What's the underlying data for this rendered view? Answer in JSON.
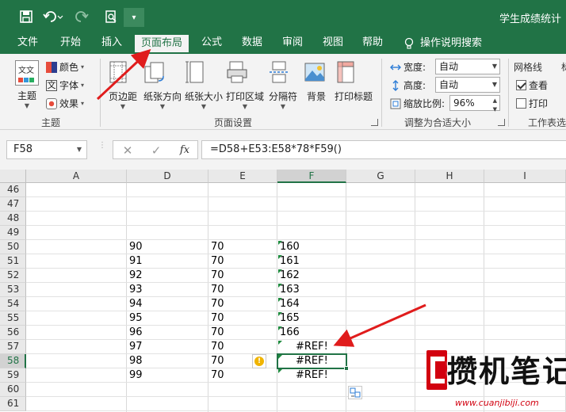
{
  "titlebar": {
    "doc_title": "学生成绩统计",
    "qat_more": "▾"
  },
  "tabs": [
    {
      "label": "文件"
    },
    {
      "label": "开始"
    },
    {
      "label": "插入"
    },
    {
      "label": "页面布局",
      "active": true
    },
    {
      "label": "公式"
    },
    {
      "label": "数据"
    },
    {
      "label": "审阅"
    },
    {
      "label": "视图"
    },
    {
      "label": "帮助"
    },
    {
      "label": "操作说明搜索"
    }
  ],
  "ribbon": {
    "theme_group": {
      "theme_label": "主题",
      "colors_label": "颜色",
      "fonts_label": "字体",
      "effects_label": "效果",
      "group_label": "主题"
    },
    "page_setup": {
      "margins": "页边距",
      "orientation": "纸张方向",
      "size": "纸张大小",
      "print_area": "打印区域",
      "breaks": "分隔符",
      "background": "背景",
      "print_titles": "打印标题",
      "group_label": "页面设置"
    },
    "scale": {
      "width_label": "宽度:",
      "width_value": "自动",
      "height_label": "高度:",
      "height_value": "自动",
      "scale_label": "缩放比例:",
      "scale_value": "96%",
      "group_label": "调整为合适大小"
    },
    "sheet_options": {
      "gridlines_label": "网格线",
      "view_label": "查看",
      "print_label": "打印",
      "group_label": "工作表选",
      "headings_fragment": "标"
    }
  },
  "formula_bar": {
    "name_box": "F58",
    "cancel": "✕",
    "enter": "✓",
    "fx": "fx",
    "formula": "=D58+E53:E58*78*F59()"
  },
  "grid": {
    "columns": [
      "A",
      "D",
      "E",
      "F",
      "G",
      "H",
      "I"
    ],
    "selected_column": "F",
    "rows": [
      {
        "n": "46",
        "D": "",
        "E": "",
        "F": ""
      },
      {
        "n": "47",
        "D": "",
        "E": "",
        "F": ""
      },
      {
        "n": "48",
        "D": "",
        "E": "",
        "F": ""
      },
      {
        "n": "49",
        "D": "",
        "E": "",
        "F": ""
      },
      {
        "n": "50",
        "D": "90",
        "E": "70",
        "F": "160"
      },
      {
        "n": "51",
        "D": "91",
        "E": "70",
        "F": "161"
      },
      {
        "n": "52",
        "D": "92",
        "E": "70",
        "F": "162"
      },
      {
        "n": "53",
        "D": "93",
        "E": "70",
        "F": "163"
      },
      {
        "n": "54",
        "D": "94",
        "E": "70",
        "F": "164"
      },
      {
        "n": "55",
        "D": "95",
        "E": "70",
        "F": "165"
      },
      {
        "n": "56",
        "D": "96",
        "E": "70",
        "F": "166"
      },
      {
        "n": "57",
        "D": "97",
        "E": "70",
        "F": "#REF!"
      },
      {
        "n": "58",
        "D": "98",
        "E": "70",
        "F": "#REF!"
      },
      {
        "n": "59",
        "D": "99",
        "E": "70",
        "F": "#REF!"
      },
      {
        "n": "60",
        "D": "",
        "E": "",
        "F": ""
      },
      {
        "n": "61",
        "D": "",
        "E": "",
        "F": ""
      }
    ],
    "selected_row": "58"
  },
  "watermark": {
    "text": "攒机笔记",
    "url": "www.cuanjibiji.com"
  },
  "colors": {
    "excel_green": "#217346",
    "annotation_red": "#e01c1c"
  }
}
